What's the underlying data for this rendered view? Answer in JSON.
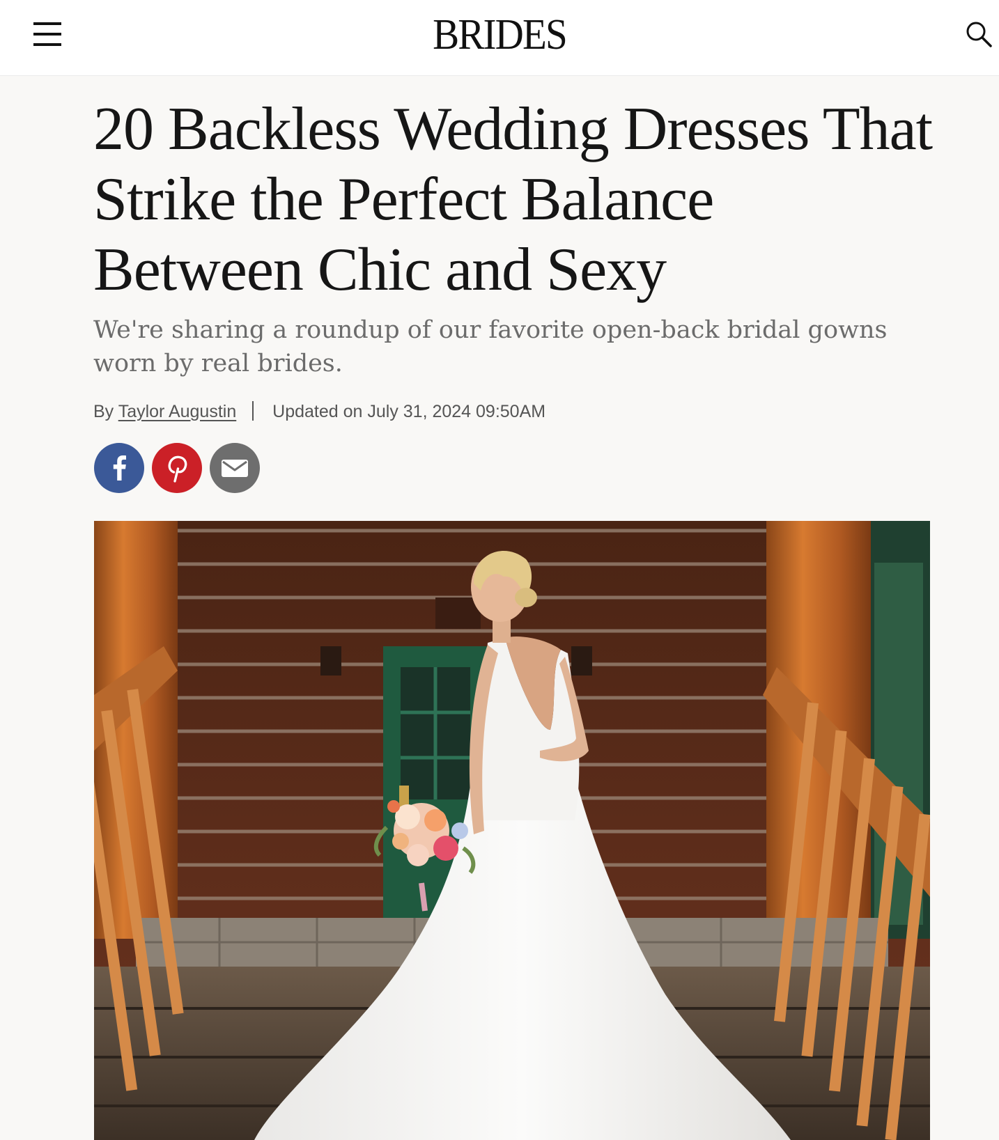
{
  "header": {
    "brand": "BRIDES",
    "menu_icon": "hamburger-menu-icon",
    "search_icon": "search-icon"
  },
  "article": {
    "title": "20 Backless Wedding Dresses That Strike the Perfect Balance Between Chic and Sexy",
    "dek": "We're sharing a roundup of our favorite open-back bridal gowns worn by real brides.",
    "byline": {
      "prefix": "By",
      "author": "Taylor Augustin",
      "updated": "Updated on July 31, 2024 09:50AM"
    }
  },
  "share": [
    {
      "icon": "facebook-icon",
      "color": "#3b5998"
    },
    {
      "icon": "pinterest-icon",
      "color": "#cb2027"
    },
    {
      "icon": "email-icon",
      "color": "#6e6e6e"
    }
  ],
  "colors": {
    "page_background": "#f9f8f6",
    "header_background": "#ffffff",
    "headline": "#161616",
    "dek": "#6b6b6b"
  }
}
